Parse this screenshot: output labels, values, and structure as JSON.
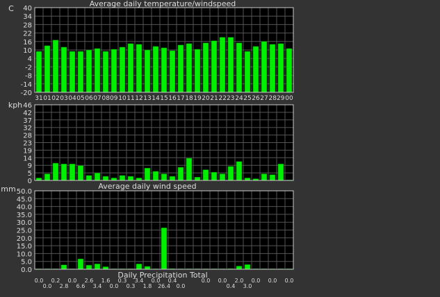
{
  "colors": {
    "background": "#333333",
    "plot_background": "#000000",
    "bar": "#00ee00",
    "bar_outline": "#007700",
    "grid": "#555555",
    "frame": "#cccccc",
    "text": "#dddddd"
  },
  "chart_data": [
    {
      "id": "temperature",
      "type": "bar",
      "title": "Average daily temperature/windspeed",
      "unit_label": "C",
      "ylim": [
        -20,
        40
      ],
      "yticks": [
        40,
        34,
        28,
        22,
        16,
        10,
        4,
        -2,
        -8,
        -14,
        -20
      ],
      "grid": true,
      "categories": [
        "31",
        "01",
        "02",
        "03",
        "04",
        "05",
        "06",
        "07",
        "08",
        "09",
        "10",
        "11",
        "12",
        "13",
        "14",
        "15",
        "16",
        "17",
        "18",
        "19",
        "20",
        "21",
        "22",
        "23",
        "24",
        "25",
        "26",
        "27",
        "28",
        "29",
        "00"
      ],
      "category_labels": [
        "31",
        "01",
        "02",
        "03",
        "04",
        "05",
        "06",
        "07",
        "0809",
        "",
        "10",
        "11",
        "12",
        "13",
        "14",
        "15",
        "16",
        "17",
        "18",
        "19",
        "20",
        "21",
        "2223",
        "",
        "24",
        "25",
        "26",
        "27",
        "2829",
        "",
        "00"
      ],
      "values": [
        9,
        13,
        17,
        12,
        9,
        9,
        10,
        11,
        9,
        10.5,
        12,
        14.5,
        14,
        10,
        12.5,
        11.5,
        9.5,
        13.5,
        14.5,
        10.5,
        15,
        16.5,
        19,
        19,
        15,
        9,
        12.5,
        16,
        14,
        14.5,
        11
      ]
    },
    {
      "id": "windspeed",
      "type": "bar",
      "title": "Average daily wind speed",
      "unit_label": "kph",
      "ylim": [
        0,
        46
      ],
      "yticks": [
        46,
        42,
        37,
        32,
        28,
        23,
        19,
        14,
        9,
        5,
        0
      ],
      "grid": true,
      "categories": [
        "31",
        "01",
        "02",
        "03",
        "04",
        "05",
        "06",
        "07",
        "08",
        "09",
        "10",
        "11",
        "12",
        "13",
        "14",
        "15",
        "16",
        "17",
        "18",
        "19",
        "20",
        "21",
        "22",
        "23",
        "24",
        "25",
        "26",
        "27",
        "28",
        "29",
        "00"
      ],
      "values": [
        1.5,
        4,
        10.5,
        10,
        10,
        9,
        3,
        4.5,
        2.5,
        1.5,
        3,
        2.5,
        1.5,
        7.5,
        5.5,
        4,
        2.5,
        8,
        13.5,
        2,
        6.5,
        5,
        4,
        8.5,
        11.5,
        1.5,
        1,
        4,
        3.5,
        10,
        0
      ]
    },
    {
      "id": "precipitation",
      "type": "bar",
      "title": "Daily Precipitation Total",
      "unit_label": "mm",
      "ylim": [
        0,
        50
      ],
      "yticks": [
        "50.0",
        "45.0",
        "40.0",
        "35.0",
        "30.0",
        "25.0",
        "20.0",
        "15.0",
        "10.0",
        "5.0",
        "0.0"
      ],
      "grid": true,
      "categories": [
        "31",
        "01",
        "02",
        "03",
        "04",
        "05",
        "06",
        "07",
        "08",
        "09",
        "10",
        "11",
        "12",
        "13",
        "14",
        "15",
        "16",
        "17",
        "18",
        "19",
        "20",
        "21",
        "22",
        "23",
        "24",
        "25",
        "26",
        "27",
        "28",
        "29",
        "00"
      ],
      "values": [
        0,
        0,
        0.2,
        2.8,
        0,
        6.6,
        2.6,
        3.4,
        1.6,
        0,
        0.3,
        0.3,
        3.4,
        1.8,
        0,
        26.4,
        0.4,
        0,
        0,
        0,
        0,
        0,
        0,
        0.4,
        2,
        3,
        0,
        0,
        0,
        0,
        0
      ],
      "value_labels": [
        "0.0",
        "0.0",
        "0.2",
        "2.8",
        "0.0",
        "6.6",
        "2.6",
        "3.4",
        "1.6",
        "0.0",
        "0.3",
        "0.3",
        "3.4",
        "1.8",
        "0.0",
        "26.4",
        "0.4",
        "0.0",
        "",
        "",
        "0.0",
        "",
        "0.0",
        "0.4",
        "2.0",
        "3.0",
        "0.0",
        "",
        "0.0",
        "",
        "0.0"
      ]
    }
  ]
}
